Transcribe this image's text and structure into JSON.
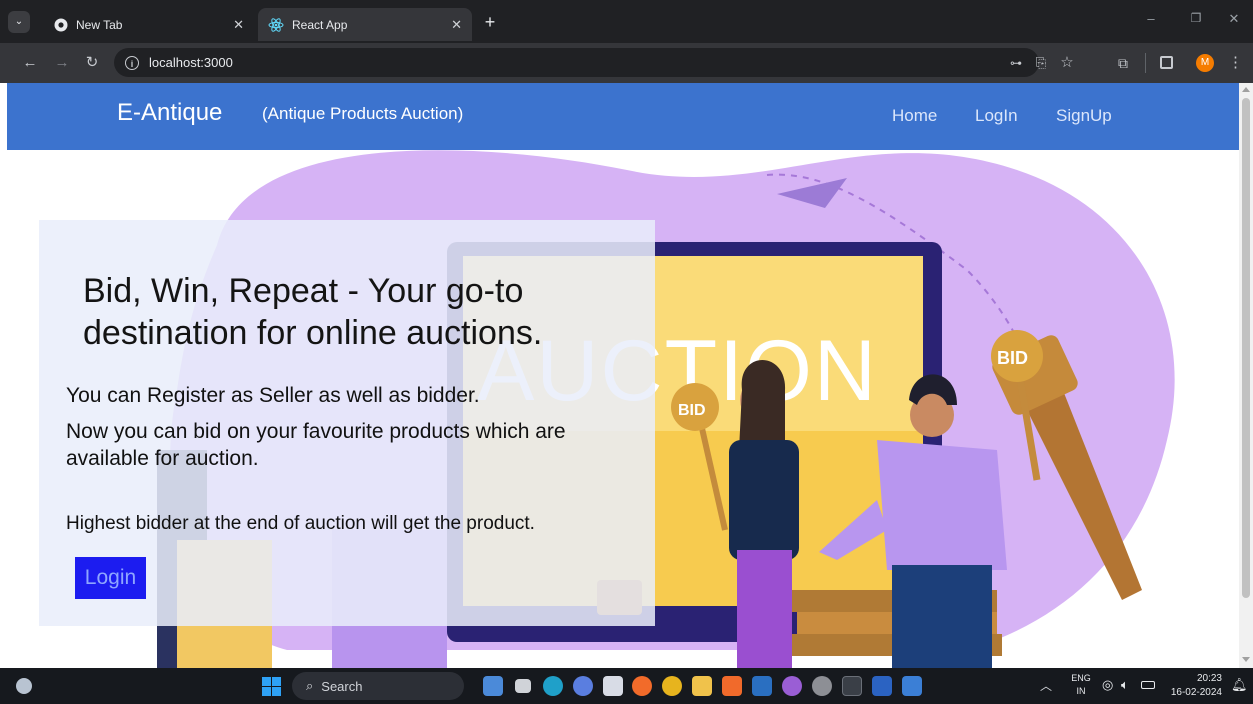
{
  "browser": {
    "tabs": [
      {
        "title": "New Tab",
        "icon": "chrome-icon"
      },
      {
        "title": "React App",
        "icon": "react-icon"
      }
    ],
    "new_tab_label": "+",
    "address": "localhost:3000"
  },
  "navbar": {
    "brand": "E-Antique",
    "tagline": "(Antique Products Auction)",
    "links": [
      "Home",
      "LogIn",
      "SignUp"
    ]
  },
  "hero": {
    "image_text": {
      "word": "AUCTION",
      "sign1": "BID",
      "sign2": "BID"
    },
    "headline": "Bid, Win, Repeat - Your go-to destination for online auctions.",
    "line1": "You can Register as Seller as well as bidder.",
    "line2": "Now you can bid on your favourite products which are available for auction.",
    "line3": "Highest bidder at the end of auction will get the product.",
    "login_button": "Login"
  },
  "taskbar": {
    "search_placeholder": "Search",
    "lang_top": "ENG",
    "lang_bottom": "IN",
    "time": "20:23",
    "date": "16-02-2024"
  },
  "colors": {
    "navbar": "#3c73ce",
    "login_button": "#1c1cf0",
    "hero_blob": "#d8b4f8"
  }
}
